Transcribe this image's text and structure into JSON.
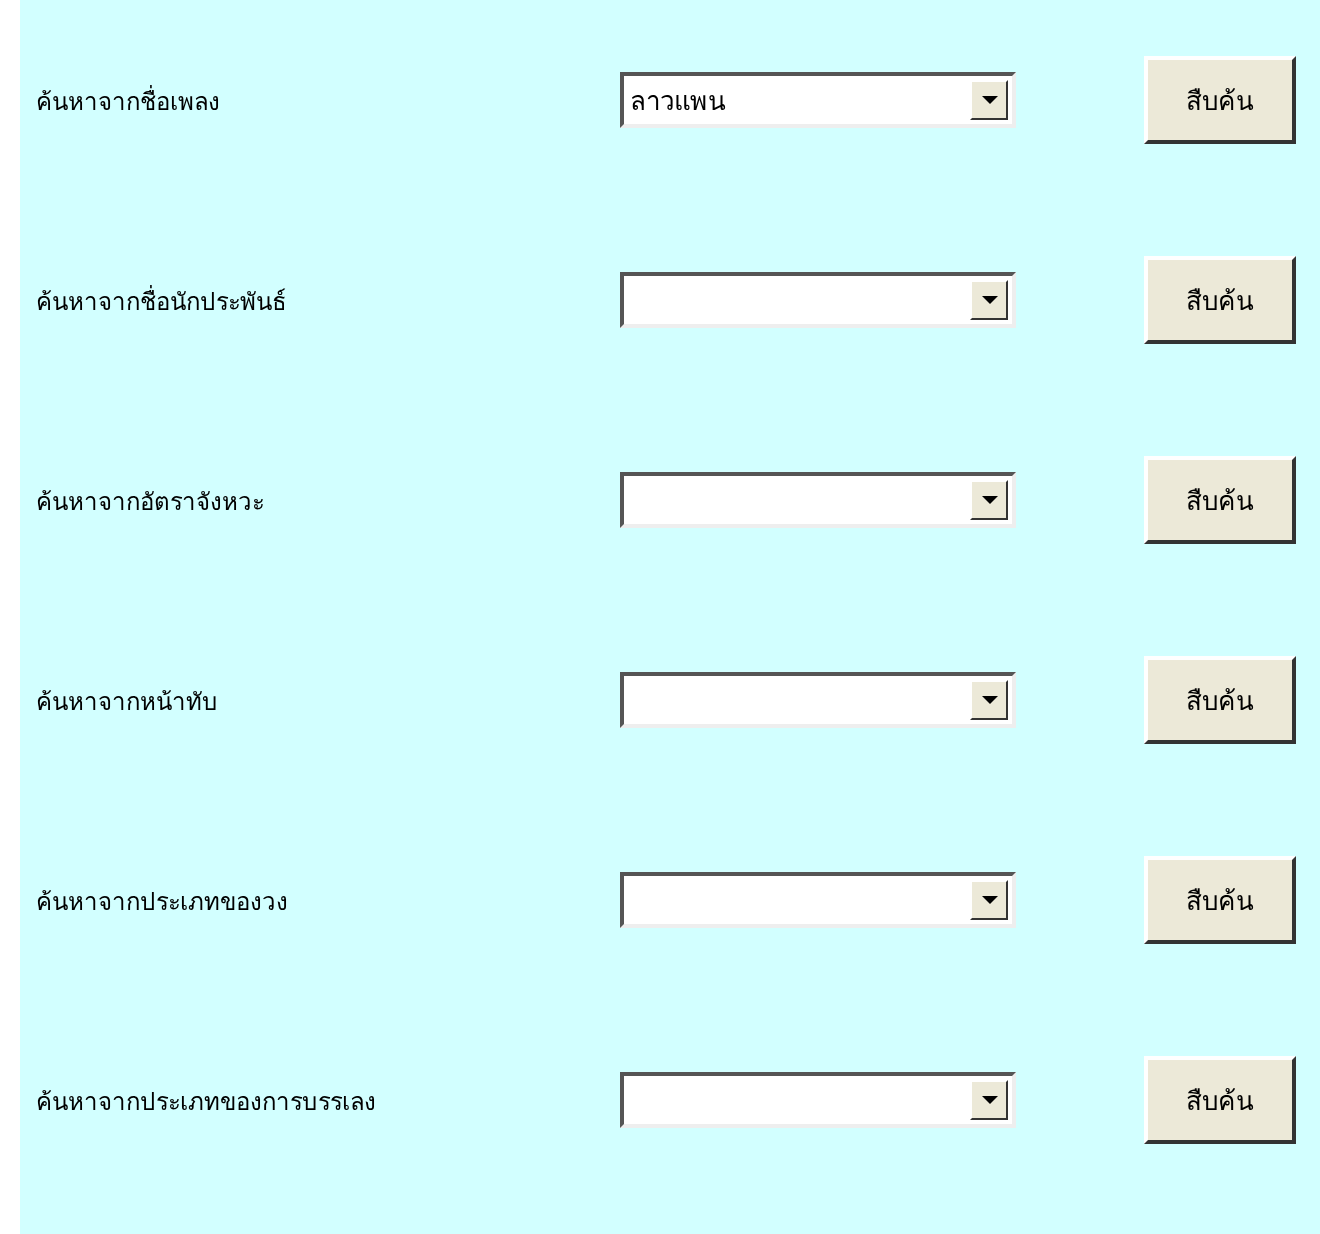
{
  "search_rows": [
    {
      "label": "ค้นหาจากชื่อเพลง",
      "dropdown": {
        "value": "ลาวแพน"
      },
      "button": "สืบค้น"
    },
    {
      "label": "ค้นหาจากชื่อนักประพันธ์",
      "dropdown": {},
      "button": "สืบค้น"
    },
    {
      "label": "ค้นหาจากอัตราจังหวะ",
      "dropdown": {},
      "button": "สืบค้น"
    },
    {
      "label": "ค้นหาจากหน้าทับ",
      "dropdown": {},
      "button": "สืบค้น"
    },
    {
      "label": "ค้นหาจากประเภทของวง",
      "dropdown": {},
      "button": "สืบค้น"
    },
    {
      "label": "ค้นหาจากประเภทของการบรรเลง",
      "dropdown": {},
      "button": "สืบค้น"
    }
  ]
}
